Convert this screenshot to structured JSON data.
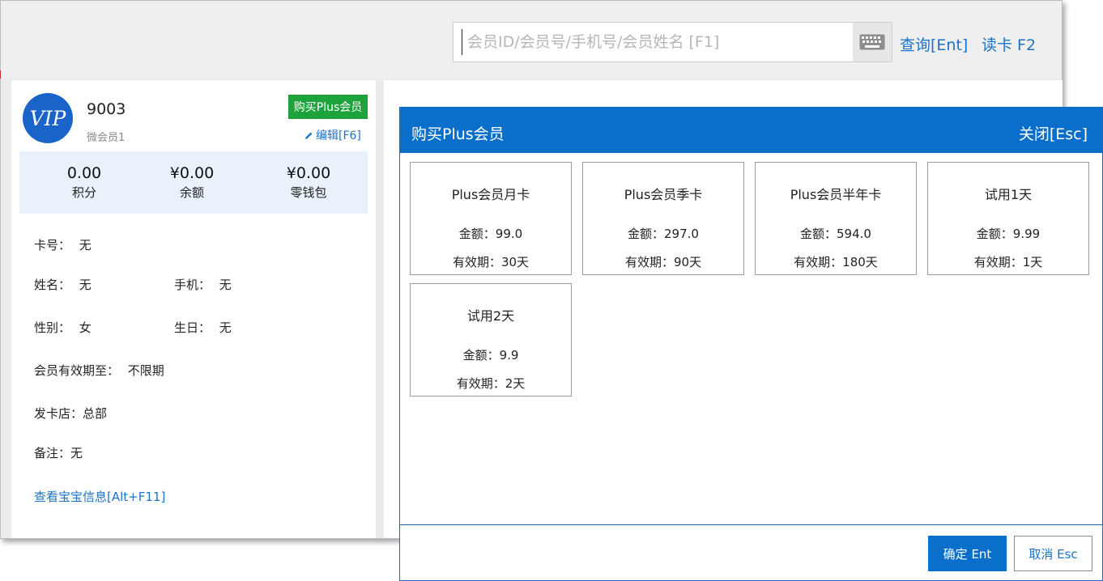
{
  "search": {
    "placeholder": "会员ID/会员号/手机号/会员姓名 [F1]",
    "value": "",
    "keyboard_icon": "keyboard-icon"
  },
  "toolbar": {
    "query_label": "查询[Ent]",
    "readcard_label": "读卡 F2"
  },
  "member": {
    "avatar_text": "VIP",
    "id": "9003",
    "type": "微会员1",
    "buy_plus_label": "购买Plus会员",
    "edit_label": "编辑[F6]",
    "stats": [
      {
        "value": "0.00",
        "label": "积分"
      },
      {
        "value": "¥0.00",
        "label": "余额"
      },
      {
        "value": "¥0.00",
        "label": "零钱包"
      }
    ],
    "card_no": {
      "label": "卡号：",
      "value": "无"
    },
    "name": {
      "label": "姓名：",
      "value": "无"
    },
    "phone": {
      "label": "手机：",
      "value": "无"
    },
    "gender": {
      "label": "性别：",
      "value": "女"
    },
    "birthday": {
      "label": "生日：",
      "value": "无"
    },
    "expiry": {
      "label": "会员有效期至：",
      "value": "不限期"
    },
    "store": {
      "label": "发卡店：",
      "value": "总部"
    },
    "note": {
      "label": "备注：",
      "value": "无"
    },
    "baby_link": "查看宝宝信息[Alt+F11]"
  },
  "modal": {
    "title": "购买Plus会员",
    "close_label": "关闭[Esc]",
    "plans": [
      {
        "name": "Plus会员月卡",
        "amount": "金额：99.0",
        "validity": "有效期：30天"
      },
      {
        "name": "Plus会员季卡",
        "amount": "金额：297.0",
        "validity": "有效期：90天"
      },
      {
        "name": "Plus会员半年卡",
        "amount": "金额：594.0",
        "validity": "有效期：180天"
      },
      {
        "name": "试用1天",
        "amount": "金额：9.99",
        "validity": "有效期：1天"
      },
      {
        "name": "试用2天",
        "amount": "金额：9.9",
        "validity": "有效期：2天"
      }
    ],
    "confirm_label": "确定 Ent",
    "cancel_label": "取消 Esc"
  },
  "colors": {
    "primary": "#0a6fca",
    "success": "#1ea33c",
    "link": "#1b73c9",
    "stats_bg": "#e9f2fb"
  }
}
